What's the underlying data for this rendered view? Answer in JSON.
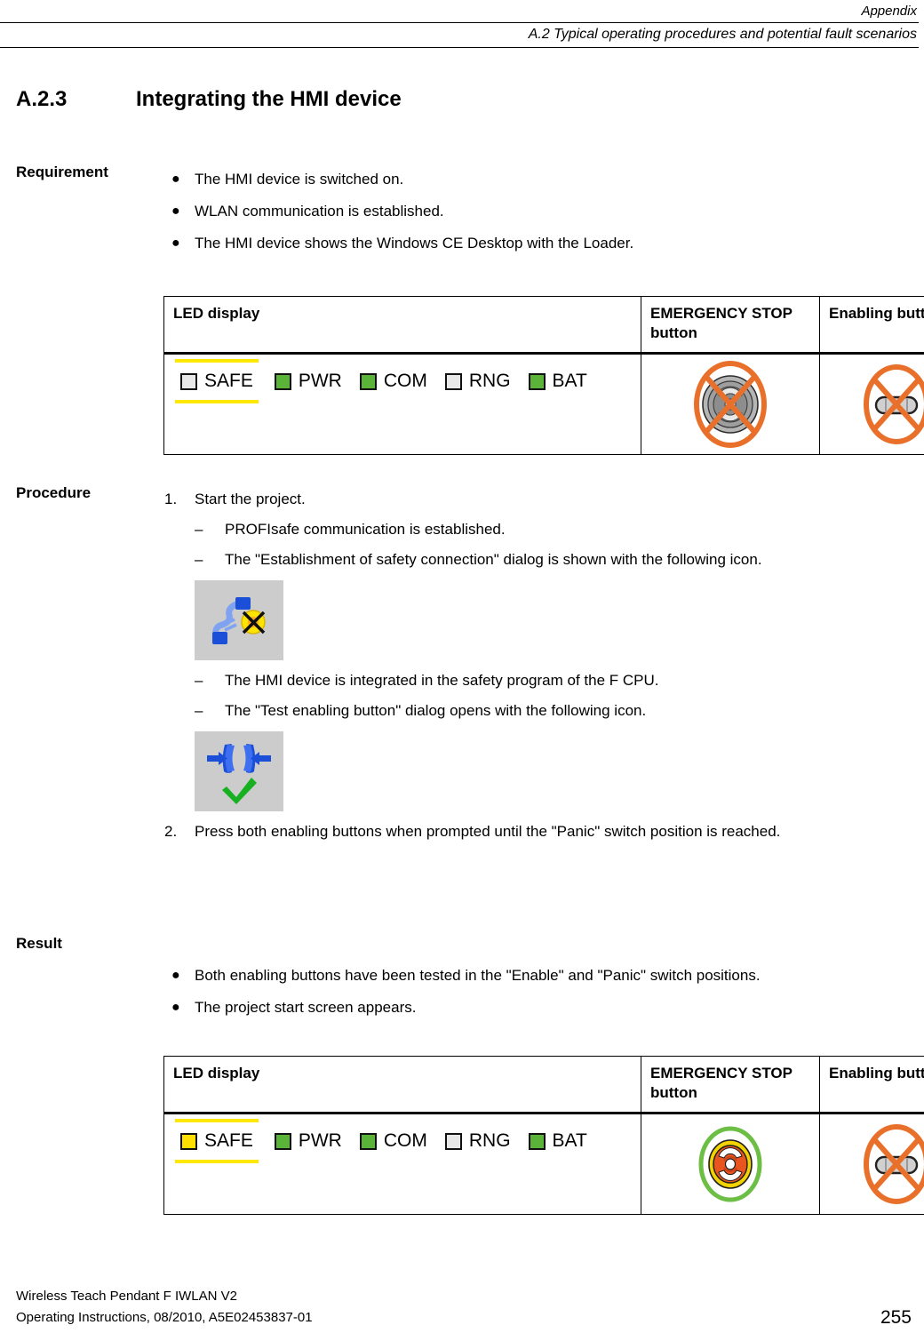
{
  "header": {
    "line1": "Appendix",
    "line2": "A.2 Typical operating procedures and potential fault scenarios"
  },
  "section": {
    "number": "A.2.3",
    "title": "Integrating the HMI device"
  },
  "requirement": {
    "label": "Requirement",
    "bullet_glyph": "●",
    "items": [
      "The HMI device is switched on.",
      "WLAN communication is established.",
      "The HMI device shows the Windows CE Desktop with the Loader."
    ]
  },
  "procedure": {
    "label": "Procedure",
    "dash_glyph": "–",
    "step1": {
      "number": "1.",
      "text": "Start the project.",
      "subitems": [
        "PROFIsafe communication is established.",
        "The \"Establishment of safety connection\" dialog is shown with the following icon.",
        "The HMI device is integrated in the safety program of the F CPU.",
        "The \"Test enabling button\" dialog opens with the following icon."
      ]
    },
    "step2": {
      "number": "2.",
      "text": "Press both enabling buttons when prompted until the \"Panic\" switch position is reached."
    },
    "icons": {
      "safety_connection": "safety-connection-broken-icon",
      "test_enabling_button": "test-enabling-button-icon"
    }
  },
  "result": {
    "label": "Result",
    "bullet_glyph": "●",
    "items": [
      "Both enabling buttons have been tested in the \"Enable\" and \"Panic\" switch positions.",
      "The project start screen appears."
    ]
  },
  "table_headers": {
    "led_display": "LED display",
    "emergency_stop": "EMERGENCY STOP button",
    "enabling_button": "Enabling button"
  },
  "table1": {
    "leds": [
      {
        "label": "SAFE",
        "state": "off",
        "highlighted": true
      },
      {
        "label": "PWR",
        "state": "green",
        "highlighted": false
      },
      {
        "label": "COM",
        "state": "green",
        "highlighted": false
      },
      {
        "label": "RNG",
        "state": "off",
        "highlighted": false
      },
      {
        "label": "BAT",
        "state": "green",
        "highlighted": false
      }
    ],
    "emergency_stop_icon": "emergency-stop-inactive-crossed-icon",
    "emergency_stop_state": "inactive",
    "enabling_button_icon": "enabling-button-crossed-icon",
    "enabling_button_state": "inactive"
  },
  "table2": {
    "leds": [
      {
        "label": "SAFE",
        "state": "yellow",
        "highlighted": true
      },
      {
        "label": "PWR",
        "state": "green",
        "highlighted": false
      },
      {
        "label": "COM",
        "state": "green",
        "highlighted": false
      },
      {
        "label": "RNG",
        "state": "off",
        "highlighted": false
      },
      {
        "label": "BAT",
        "state": "green",
        "highlighted": false
      }
    ],
    "emergency_stop_icon": "emergency-stop-active-icon",
    "emergency_stop_state": "active",
    "enabling_button_icon": "enabling-button-crossed-icon",
    "enabling_button_state": "inactive"
  },
  "footer": {
    "line1": "Wireless Teach Pendant F IWLAN V2",
    "line2": "Operating Instructions, 08/2010, A5E02453837-01",
    "page_number": "255"
  },
  "colors": {
    "led_green": "#5bb33a",
    "led_yellow": "#ffe000",
    "led_off": "#e8e8e8",
    "highlight_yellow": "#ffe800",
    "prohibition_orange": "#e8702a",
    "estop_red": "#e8551f",
    "estop_ring_yellow": "#f2d200",
    "estop_ring_green": "#6cbe45",
    "icon_bg_gray": "#cccccc",
    "icon_blue": "#1b4fd8",
    "icon_green_check": "#17b020"
  }
}
